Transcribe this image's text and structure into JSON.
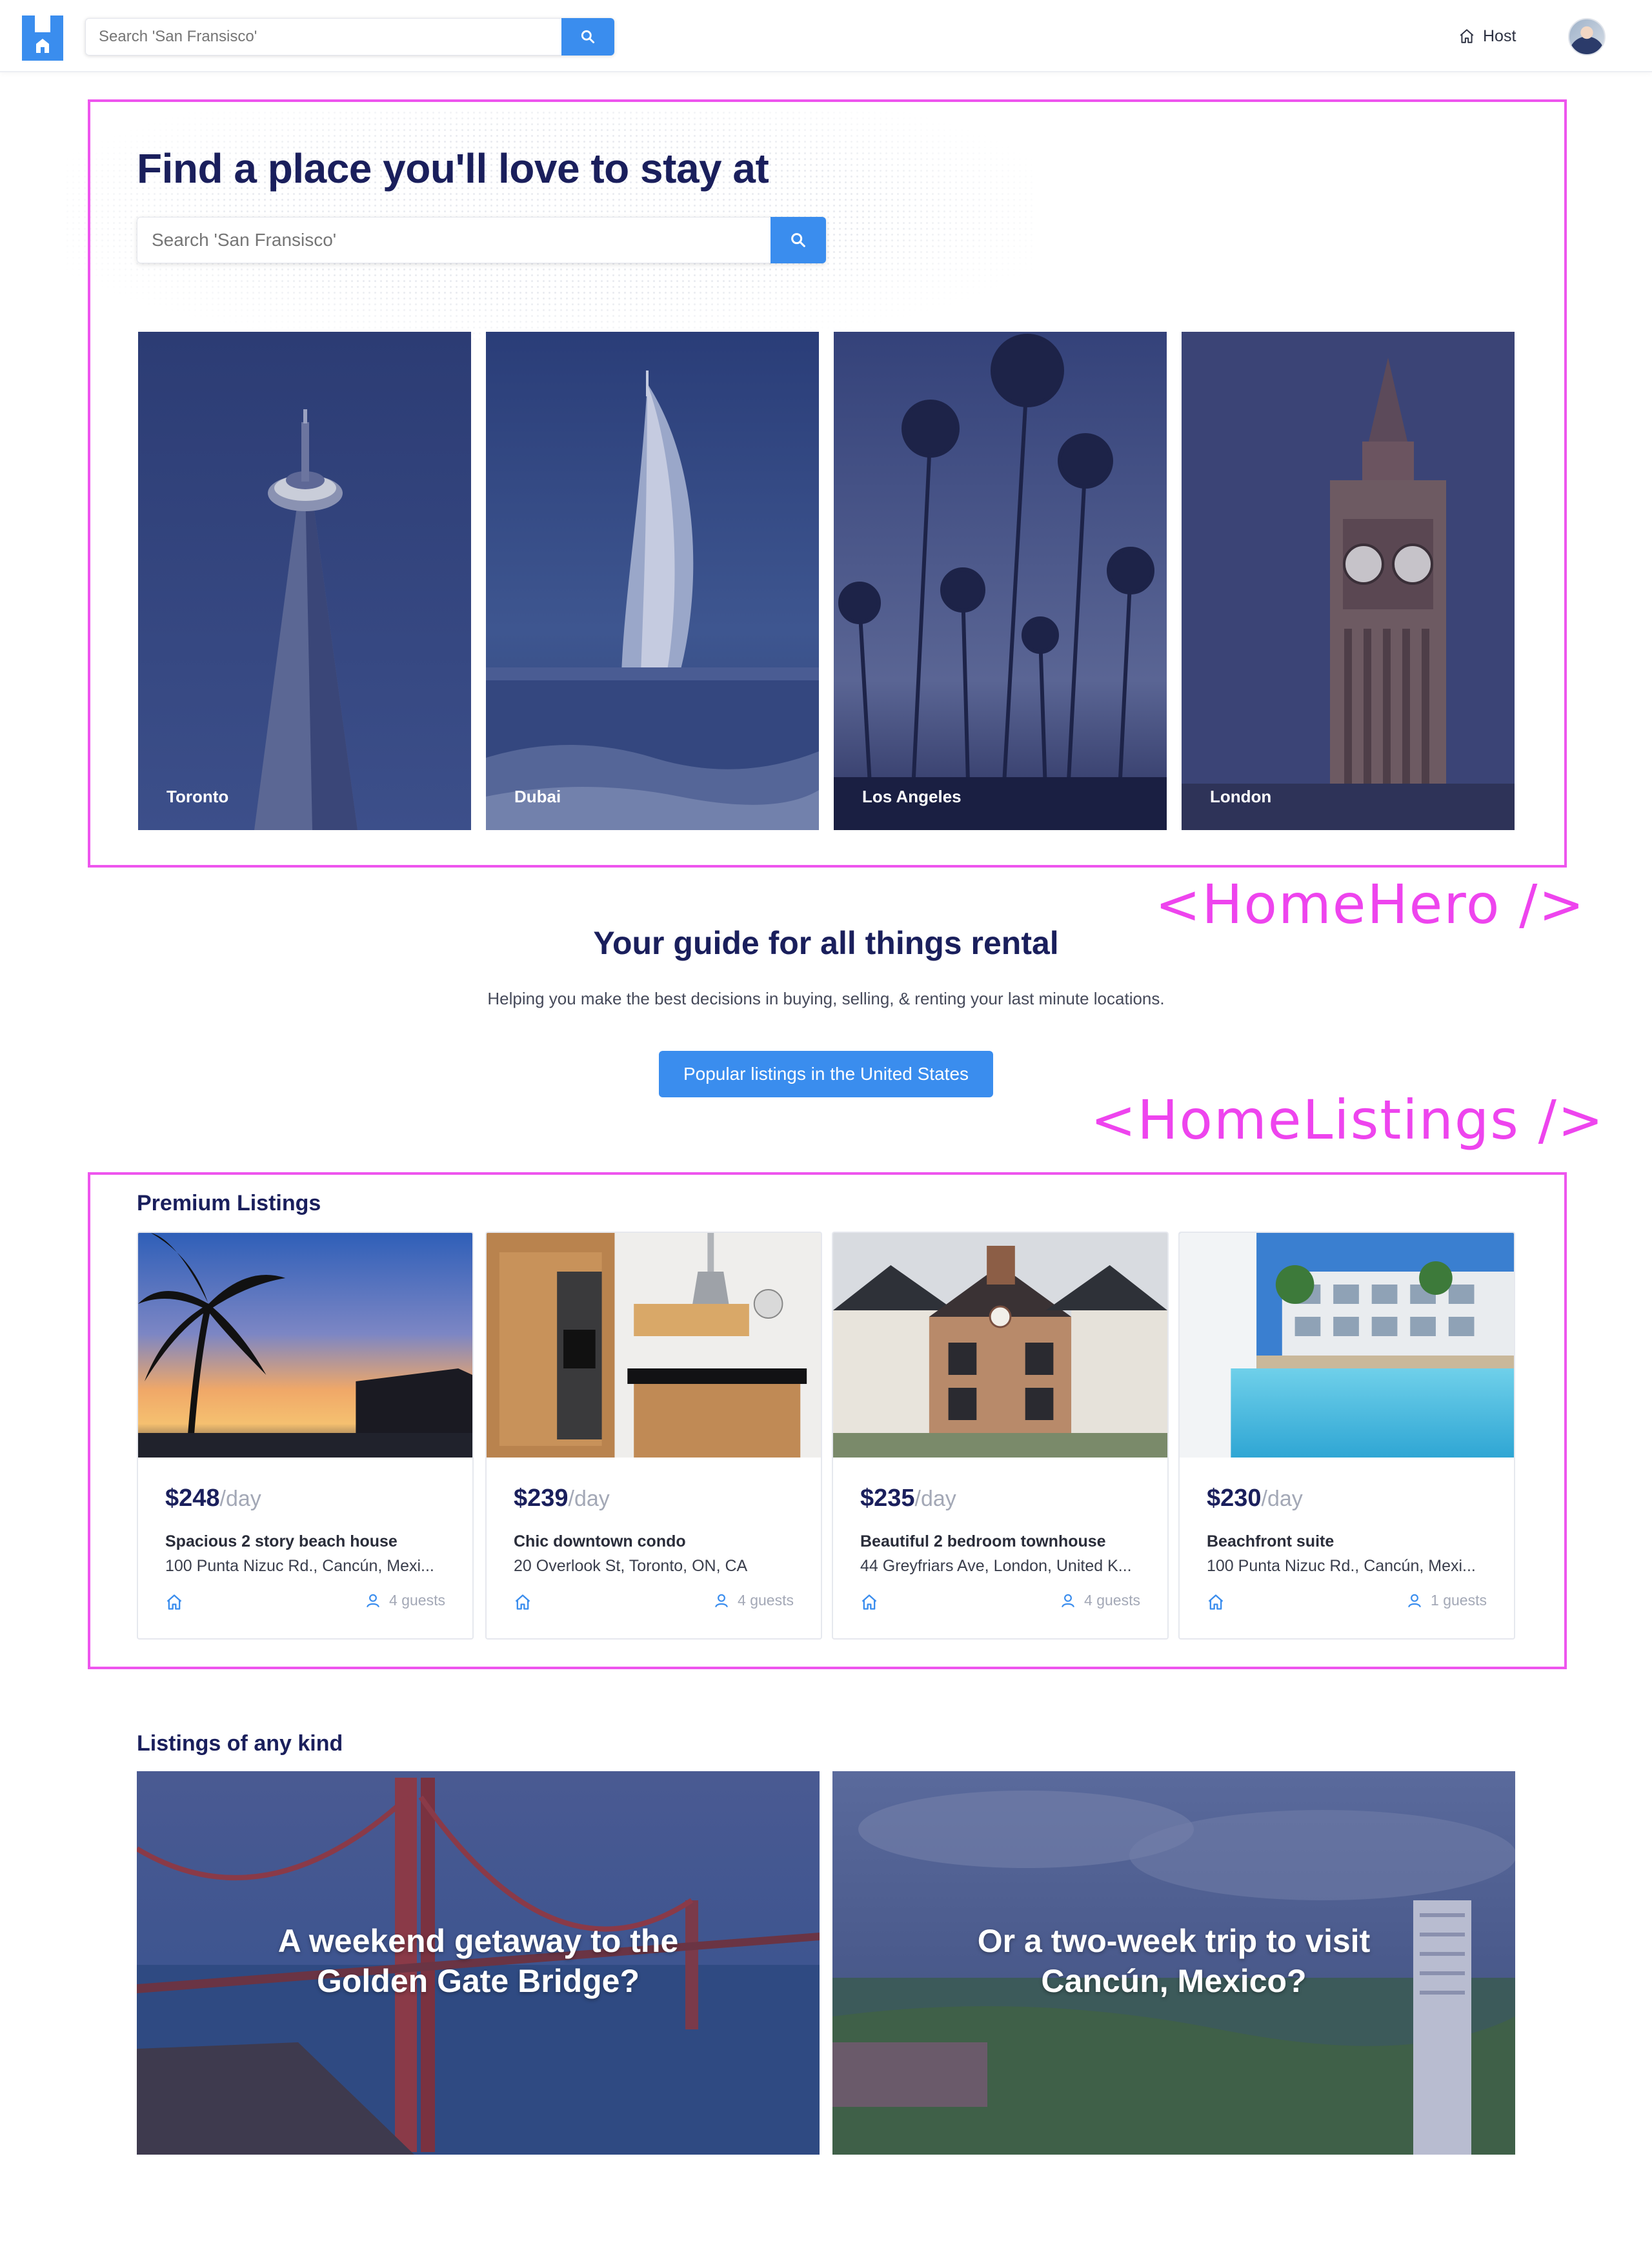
{
  "header": {
    "search_placeholder": "Search 'San Fransisco'",
    "host_label": "Host"
  },
  "annotations": {
    "hero_label": "<HomeHero />",
    "listings_label": "<HomeListings />"
  },
  "hero": {
    "title": "Find a place you'll love to stay at",
    "search_placeholder": "Search 'San Fransisco'",
    "cities": [
      {
        "name": "Toronto"
      },
      {
        "name": "Dubai"
      },
      {
        "name": "Los Angeles"
      },
      {
        "name": "London"
      }
    ]
  },
  "guide": {
    "title": "Your guide for all things rental",
    "subtitle": "Helping you make the best decisions in buying, selling, & renting your last minute locations.",
    "button_label": "Popular listings in the United States"
  },
  "premium": {
    "title": "Premium Listings",
    "per_label": "/day",
    "listings": [
      {
        "price": "$248",
        "title": "Spacious 2 story beach house",
        "address": "100 Punta Nizuc Rd., Cancún, Mexi...",
        "guests": "4 guests"
      },
      {
        "price": "$239",
        "title": "Chic downtown condo",
        "address": "20 Overlook St, Toronto, ON, CA",
        "guests": "4 guests"
      },
      {
        "price": "$235",
        "title": "Beautiful 2 bedroom townhouse",
        "address": "44 Greyfriars Ave, London, United K...",
        "guests": "4 guests"
      },
      {
        "price": "$230",
        "title": "Beachfront suite",
        "address": "100 Punta Nizuc Rd., Cancún, Mexi...",
        "guests": "1 guests"
      }
    ]
  },
  "any_kind": {
    "title": "Listings of any kind",
    "cards": [
      {
        "caption": "A weekend getaway to the\nGolden Gate Bridge?"
      },
      {
        "caption": "Or a two-week trip to visit\nCancún, Mexico?"
      }
    ]
  },
  "colors": {
    "brand_blue": "#3a8dee",
    "navy_text": "#1a1f5c",
    "annotation_pink": "#ee55ee",
    "muted_text": "#a3a8b6"
  }
}
